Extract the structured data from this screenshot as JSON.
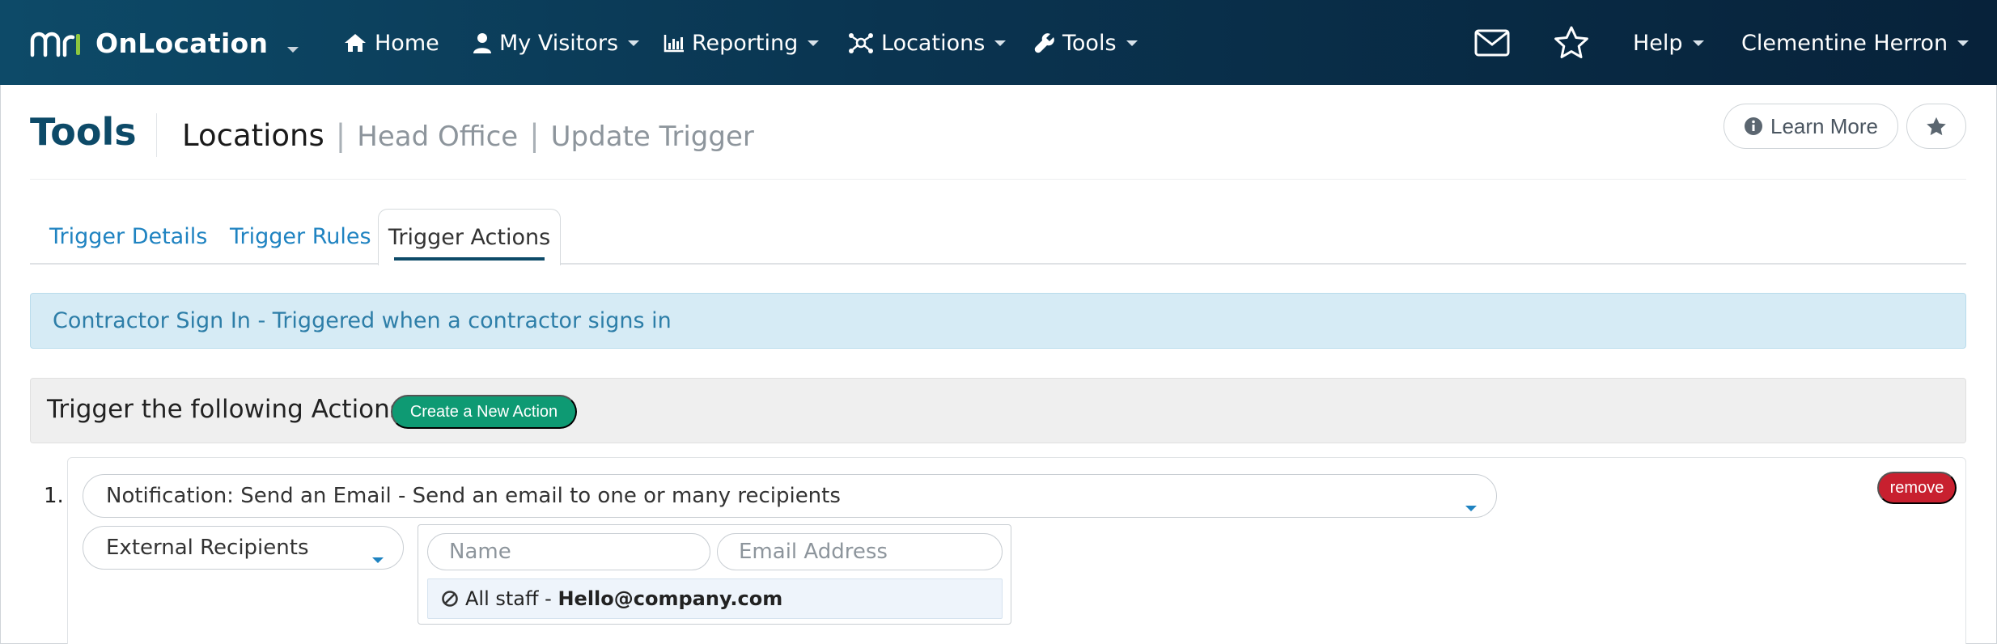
{
  "navbar": {
    "brand": "OnLocation",
    "items": [
      {
        "label": "Home",
        "icon": "home-icon"
      },
      {
        "label": "My Visitors",
        "icon": "user-icon"
      },
      {
        "label": "Reporting",
        "icon": "bar-chart-icon"
      },
      {
        "label": "Locations",
        "icon": "network-icon"
      },
      {
        "label": "Tools",
        "icon": "wrench-icon"
      }
    ],
    "help": "Help",
    "user": "Clementine Herron",
    "colors": {
      "gradient_start": "#0d4a68",
      "gradient_end": "#07223a",
      "logo_accent": "#8cc63f"
    }
  },
  "header": {
    "title": "Tools",
    "breadcrumb": {
      "primary": "Locations",
      "sep": "|",
      "items": [
        "Head Office",
        "Update Trigger"
      ]
    },
    "learn_more": "Learn More"
  },
  "tabs": [
    {
      "label": "Trigger Details",
      "active": false
    },
    {
      "label": "Trigger Rules",
      "active": false
    },
    {
      "label": "Trigger Actions",
      "active": true
    }
  ],
  "alert": {
    "text": "Contractor Sign In - Triggered when a contractor signs in"
  },
  "actions": {
    "heading": "Trigger the following Actions",
    "create_button": "Create a New Action",
    "items": [
      {
        "number": "1.",
        "type": "Notification: Send an Email - Send an email to one or many recipients",
        "remove_label": "remove",
        "recipient_type": "External Recipients",
        "name_placeholder": "Name",
        "email_placeholder": "Email Address",
        "recipients": [
          {
            "name": "All staff",
            "sep": " - ",
            "email": "Hello@company.com"
          }
        ]
      }
    ]
  },
  "colors": {
    "accent": "#0d4a68",
    "link": "#1f83c1",
    "success": "#0e9a73",
    "danger": "#c8202f",
    "info_bg": "#d6ebf5"
  }
}
